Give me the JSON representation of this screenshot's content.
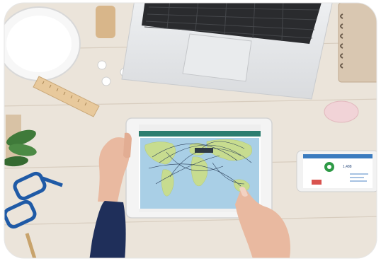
{
  "scene": {
    "description_free": true
  },
  "tablet_screen": {
    "browser_url": "",
    "app_tab": "",
    "map_tooltip": ""
  },
  "phone_screen": {
    "stat_value": "1,488"
  },
  "colors": {
    "desk_wood": "#e9e2d8",
    "desk_grain": "#d9cfc2",
    "laptop_body": "#e4e5e7",
    "keyboard": "#2a2b2e",
    "tablet_frame": "#f4f4f4",
    "map_ocean": "#a9cfe6",
    "map_land": "#c7dc8f",
    "app_header": "#2c7d6f",
    "glasses": "#1f5aa6",
    "plant": "#3f7a3a",
    "sleeve": "#1f2f5a",
    "skin": "#e9b9a0",
    "mouse": "#f1d2d6",
    "notebook": "#d8c6b1",
    "ruler": "#e6c79a"
  }
}
